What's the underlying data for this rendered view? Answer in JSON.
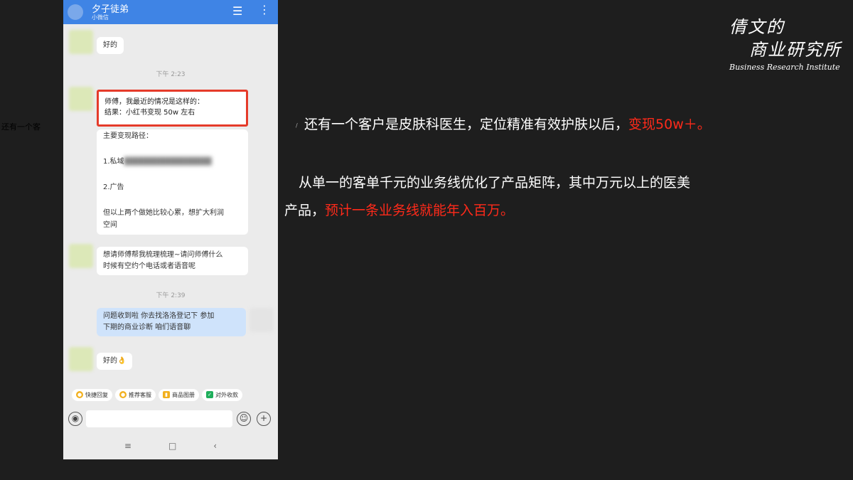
{
  "stray_label": "还有一个客",
  "chat": {
    "title": "夕子徒弟",
    "subtitle": "小微信",
    "messages": {
      "m1": "好的",
      "t1": "下午 2:23",
      "highlight_line1": "师傅，我最近的情况是这样的：",
      "highlight_line2": "结果：小红书变现 50w 左右",
      "path_title": "主要变现路径：",
      "path_1": "1.私域",
      "path_2": "2.广告",
      "path_3": "但以上两个做她比较心累，想扩大利润",
      "path_4": "空间",
      "m3_line1": "想请师傅帮我梳理梳理~请问师傅什么",
      "m3_line2": "时候有空约个电话或者语音呢",
      "t2": "下午 2:39",
      "reply_line1": "问题收到啦  你去找洛洛登记下  参加",
      "reply_line2": "下期的商业诊断  咱们语音聊",
      "m5": "好的👌"
    },
    "quick_actions": [
      "快捷回复",
      "推荐客服",
      "商品图册",
      "对外收款"
    ]
  },
  "logo": {
    "line1": "倩文的",
    "line2": "商业研究所",
    "line3": "Business Research Institute"
  },
  "paragraph1": {
    "text": "还有一个客户是皮肤科医生，定位精准有效护肤以后，",
    "highlight": "变现50w＋。"
  },
  "paragraph2": {
    "line1": "从单一的客单千元的业务线优化了产品矩阵，其中万元以上的医美",
    "line2_prefix": "产品，",
    "line2_highlight": "预计一条业务线就能年入百万。"
  },
  "colors": {
    "accent_red": "#ff2a1a",
    "header_blue": "#3f84e5",
    "slide_bg": "#1e1e1e"
  }
}
